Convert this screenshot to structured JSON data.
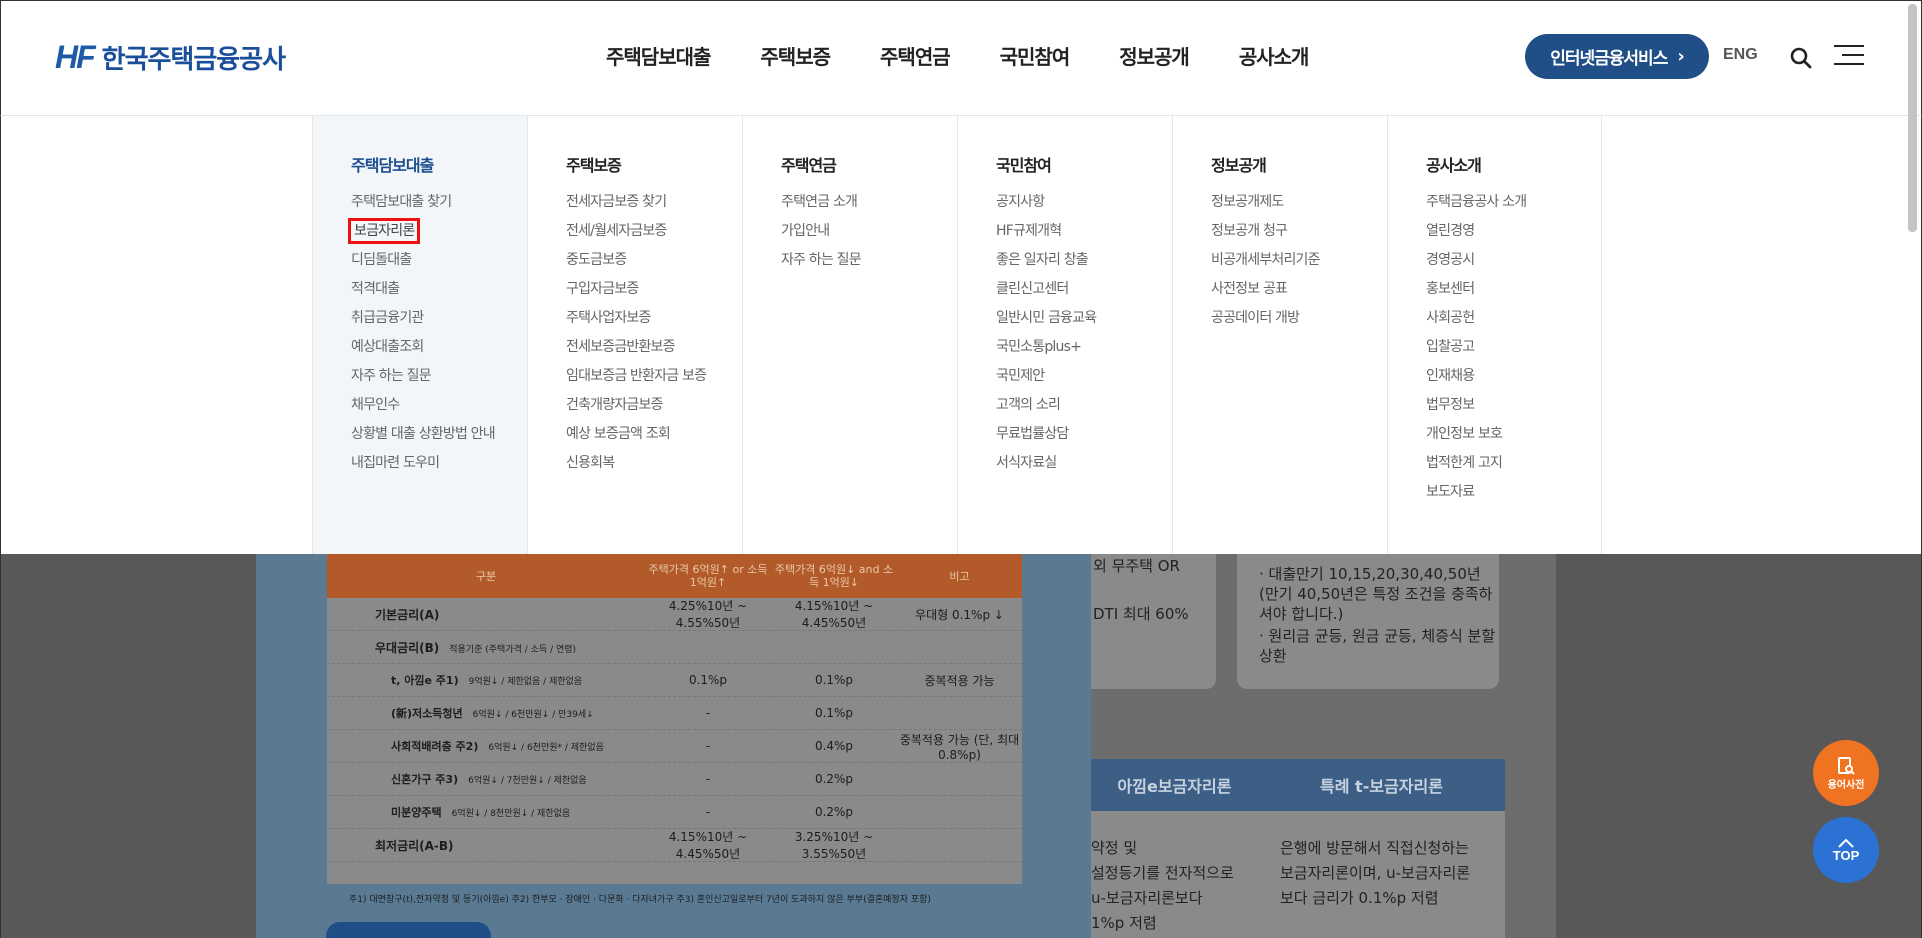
{
  "header": {
    "logo_mark": "HF",
    "logo_text": "한국주택금융공사",
    "nav": [
      "주택담보대출",
      "주택보증",
      "주택연금",
      "국민참여",
      "정보공개",
      "공사소개"
    ],
    "service_button": "인터넷금융서비스",
    "lang": "ENG"
  },
  "menu": {
    "columns": [
      {
        "title": "주택담보대출",
        "items": [
          "주택담보대출 찾기",
          "보금자리론",
          "디딤돌대출",
          "적격대출",
          "취급금융기관",
          "예상대출조회",
          "자주 하는 질문",
          "채무인수",
          "상황별 대출 상환방법 안내",
          "내집마련 도우미"
        ]
      },
      {
        "title": "주택보증",
        "items": [
          "전세자금보증 찾기",
          "전세/월세자금보증",
          "중도금보증",
          "구입자금보증",
          "주택사업자보증",
          "전세보증금반환보증",
          "임대보증금 반환자금 보증",
          "건축개량자금보증",
          "예상 보증금액 조회",
          "신용회복"
        ]
      },
      {
        "title": "주택연금",
        "items": [
          "주택연금 소개",
          "가입안내",
          "자주 하는 질문"
        ]
      },
      {
        "title": "국민참여",
        "items": [
          "공지사항",
          "HF규제개혁",
          "좋은 일자리 창출",
          "클린신고센터",
          "일반시민 금융교육",
          "국민소통plus+",
          "국민제안",
          "고객의 소리",
          "무료법률상담",
          "서식자료실"
        ]
      },
      {
        "title": "정보공개",
        "items": [
          "정보공개제도",
          "정보공개 청구",
          "비공개세부처리기준",
          "사전정보 공표",
          "공공데이터 개방"
        ]
      },
      {
        "title": "공사소개",
        "items": [
          "주택금융공사 소개",
          "열린경영",
          "경영공시",
          "홍보센터",
          "사회공헌",
          "입찰공고",
          "인재채용",
          "법무정보",
          "개인정보 보호",
          "법적한계 고지",
          "보도자료"
        ]
      }
    ]
  },
  "background": {
    "table_head": [
      "구분",
      "주택가격 6억원↑ or 소득 1억원↑",
      "주택가격 6억원↓ and 소득 1억원↓",
      "비고"
    ],
    "rows": [
      {
        "label": "기본금리(A)",
        "note": "",
        "v1": "4.25%10년 ~ 4.55%50년",
        "v2": "4.15%10년 ~ 4.45%50년",
        "v3": "우대형 0.1%p ↓"
      },
      {
        "label": "우대금리(B)",
        "note": "적용기준 (주택가격 / 소득 / 연령)",
        "v1": "",
        "v2": "",
        "v3": ""
      },
      {
        "label": "t, 아낌e 주1)",
        "note": "9억원↓ / 제한없음 / 제한없음",
        "v1": "0.1%p",
        "v2": "0.1%p",
        "v3": "중복적용 가능"
      },
      {
        "label": "(新)저소득청년",
        "note": "6억원↓ / 6천만원↓ / 만39세↓",
        "v1": "-",
        "v2": "0.1%p",
        "v3": ""
      },
      {
        "label": "사회적배려층 주2)",
        "note": "6억원↓ / 6천만원* / 제한없음",
        "v1": "-",
        "v2": "0.4%p",
        "v3": "중복적용 가능 (단, 최대 0.8%p)"
      },
      {
        "label": "신혼가구 주3)",
        "note": "6억원↓ / 7천만원↓ / 제한없음",
        "v1": "-",
        "v2": "0.2%p",
        "v3": ""
      },
      {
        "label": "미분양주택",
        "note": "6억원↓ / 8천만원↓ / 제한없음",
        "v1": "-",
        "v2": "0.2%p",
        "v3": ""
      },
      {
        "label": "최저금리(A-B)",
        "note": "",
        "v1": "4.15%10년 ~ 4.45%50년",
        "v2": "3.25%10년 ~ 3.55%50년",
        "v3": ""
      }
    ],
    "footnote": "주1) 대면창구(t),전자약정 및 등기(아낌e)     주2) 한부모 · 장애인 · 다문화 · 다자녀가구     주3) 혼인신고일로부터 7년이 도과하지 않은 부부(결혼예정자 포함)",
    "info1": [
      "외 무주택 OR",
      "",
      "DTI 최대 60%"
    ],
    "info2": [
      "· 대출만기 10,15,20,30,40,50년 (만기 40,50년은 특정 조건을 충족하셔야 합니다.)",
      "· 원리금 균등, 원금 균등, 체증식 분할상환"
    ],
    "prod_heads": [
      "아낌e보금자리론",
      "특례 t-보금자리론"
    ],
    "prod_body1": [
      "약정 및",
      "설정등기를 전자적으로",
      "u-보금자리론보다",
      "1%p 저렴"
    ],
    "prod_body2": [
      "은행에 방문해서 직접신청하는",
      "보금자리론이며, u-보금자리론",
      "보다 금리가 0.1%p 저렴"
    ]
  },
  "fab": {
    "dict": "용어사전",
    "top": "TOP"
  }
}
